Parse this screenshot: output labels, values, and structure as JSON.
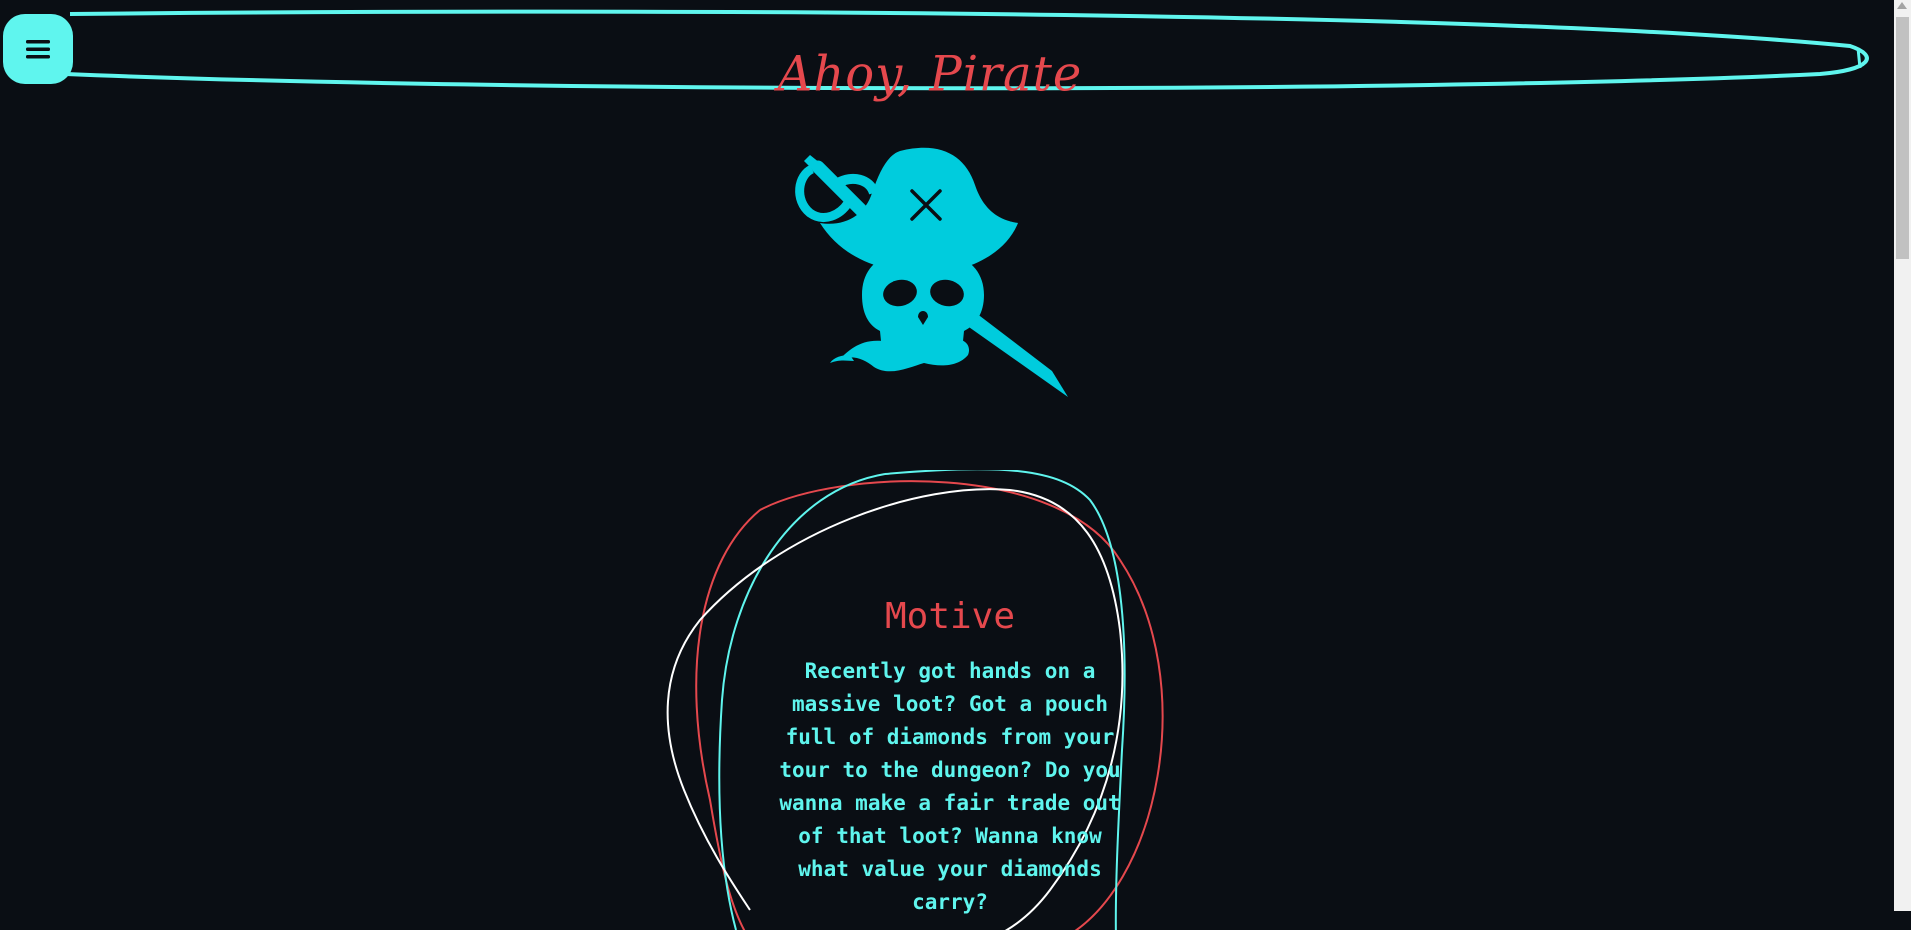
{
  "header": {
    "title": "Ahoy, Pirate",
    "menu_icon": "hamburger-menu-icon"
  },
  "logo": {
    "icon": "pirate-skull-icon"
  },
  "motive": {
    "heading": "Motive",
    "body": "Recently got hands on a massive loot? Got a pouch full of diamonds from your tour to the dungeon? Do you wanna make a fair trade out of that loot? Wanna know what value your diamonds carry?"
  },
  "colors": {
    "background": "#0a0e14",
    "accent_cyan": "#5ff5ee",
    "accent_red": "#e5484d",
    "logo_cyan": "#00ccdd"
  }
}
